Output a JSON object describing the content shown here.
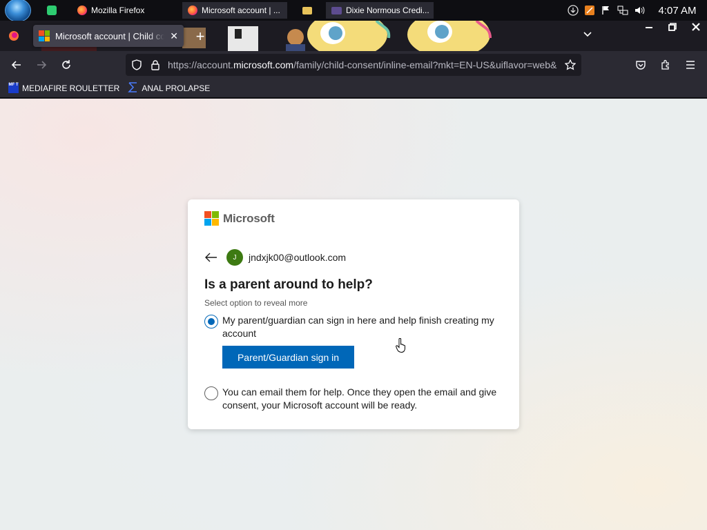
{
  "taskbar": {
    "items": [
      {
        "label": "",
        "icon": "notepad-green-icon"
      },
      {
        "label": "Mozilla Firefox",
        "icon": "firefox-icon"
      },
      {
        "label": "Microsoft account | ...",
        "icon": "firefox-icon"
      },
      {
        "label": "",
        "icon": "folder-icon"
      },
      {
        "label": "Dixie Normous Credi...",
        "icon": "media-icon"
      }
    ],
    "clock": "4:07 AM"
  },
  "browser": {
    "active_tab_title": "Microsoft account | Child consent",
    "url_prefix": "https://account.",
    "url_domain": "microsoft.com",
    "url_suffix": "/family/child-consent/inline-email?mkt=EN-US&uiflavor=web&",
    "bookmarks": [
      {
        "label": "MEDIAFIRE ROULETTER",
        "icon_text": "MF T"
      },
      {
        "label": "ANAL PROLAPSE"
      }
    ]
  },
  "card": {
    "brand": "Microsoft",
    "avatar_initial": "J",
    "email": "jndxjk00@outlook.com",
    "heading": "Is a parent around to help?",
    "subtext": "Select option to reveal more",
    "option1": "My parent/guardian can sign in here and help finish creating my account",
    "button": "Parent/Guardian sign in",
    "option2": "You can email them for help. Once they open the email and give consent, your Microsoft account will be ready."
  },
  "colors": {
    "ms_blue": "#0067b8",
    "ms_red": "#f25022",
    "ms_green": "#7fba00",
    "ms_lightblue": "#00a4ef",
    "ms_yellow": "#ffb900",
    "avatar_green": "#3d7a12"
  }
}
